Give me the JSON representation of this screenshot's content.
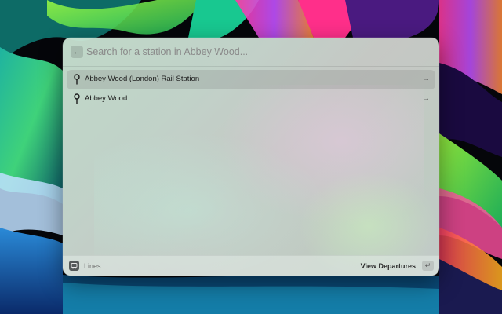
{
  "search": {
    "back_icon": "arrow-left-icon",
    "value": "",
    "placeholder": "Search for a station in Abbey Wood..."
  },
  "results": [
    {
      "title": "Abbey Wood (London) Rail Station",
      "icon": "map-pin-icon",
      "accessory": "arrow-right-icon",
      "selected": true
    },
    {
      "title": "Abbey Wood",
      "icon": "map-pin-icon",
      "accessory": "arrow-right-icon",
      "selected": false
    }
  ],
  "footer": {
    "extension_label": "Lines",
    "primary_action": "View Departures",
    "primary_shortcut": "↵"
  }
}
